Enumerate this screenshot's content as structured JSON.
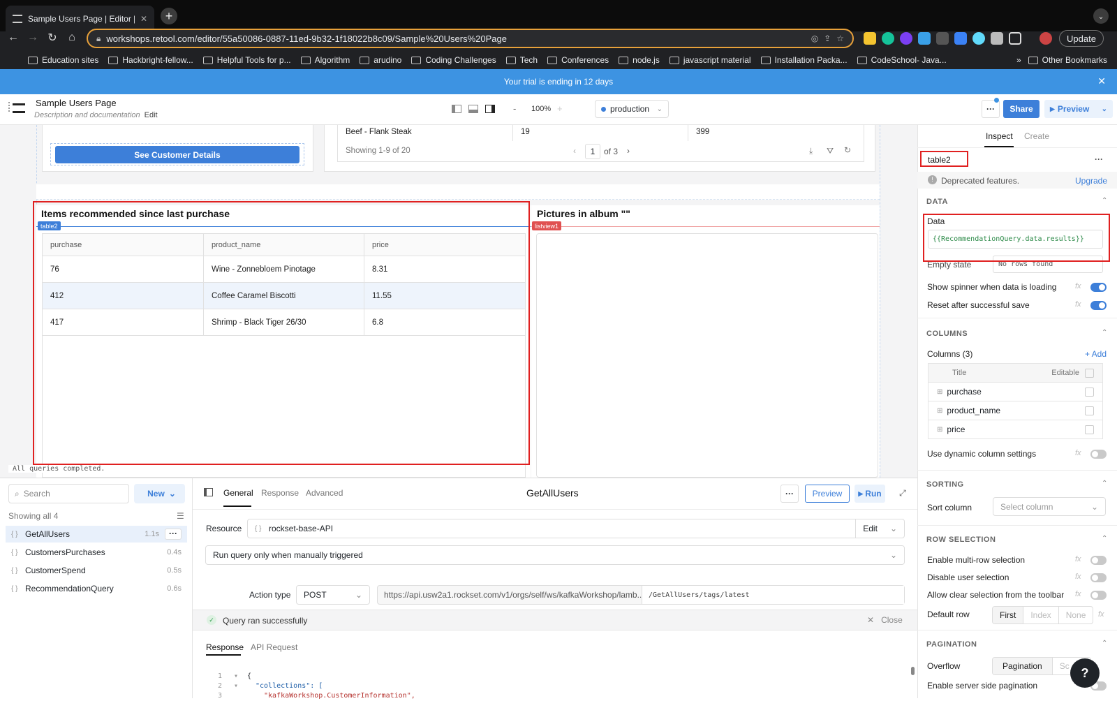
{
  "browser": {
    "tab_title": "Sample Users Page | Editor | Re",
    "url": "workshops.retool.com/editor/55a50086-0887-11ed-9b32-1f18022b8c09/Sample%20Users%20Page",
    "update_label": "Update",
    "bookmarks": [
      "Education sites",
      "Hackbright-fellow...",
      "Helpful Tools for p...",
      "Algorithm",
      "arudino",
      "Coding Challenges",
      "Tech",
      "Conferences",
      "node.js",
      "javascript material",
      "Installation Packa...",
      "CodeSchool- Java..."
    ],
    "other_bookmarks": "Other Bookmarks"
  },
  "trial_banner": "Your trial is ending in 12 days",
  "app": {
    "title": "Sample Users Page",
    "subtitle": "Description and documentation",
    "edit_label": "Edit",
    "zoom": "100%",
    "environment": "production",
    "share_label": "Share",
    "preview_label": "Preview"
  },
  "canvas": {
    "customer_button": "See Customer Details",
    "top_table": {
      "row": [
        "Beef - Flank Steak",
        "19",
        "399"
      ],
      "showing": "Showing 1-9 of 20",
      "page": "1",
      "of_pages": "of 3"
    },
    "table2": {
      "title": "Items recommended since last purchase",
      "tag": "table2",
      "columns": [
        "purchase",
        "product_name",
        "price"
      ],
      "rows": [
        [
          "76",
          "Wine - Zonnebloem Pinotage",
          "8.31"
        ],
        [
          "412",
          "Coffee Caramel Biscotti",
          "11.55"
        ],
        [
          "417",
          "Shrimp - Black Tiger 26/30",
          "6.8"
        ]
      ]
    },
    "listview": {
      "title": "Pictures in album \"\"",
      "tag": "listview1"
    },
    "status": "All queries completed."
  },
  "queries": {
    "search_placeholder": "Search",
    "new_label": "New",
    "showing": "Showing all 4",
    "items": [
      {
        "name": "GetAllUsers",
        "time": "1.1s"
      },
      {
        "name": "CustomersPurchases",
        "time": "0.4s"
      },
      {
        "name": "CustomerSpend",
        "time": "0.5s"
      },
      {
        "name": "RecommendationQuery",
        "time": "0.6s"
      }
    ]
  },
  "editor": {
    "tabs": [
      "General",
      "Response",
      "Advanced"
    ],
    "query_name": "GetAllUsers",
    "preview_label": "Preview",
    "run_label": "Run",
    "resource_label": "Resource",
    "resource": "rockset-base-API",
    "resource_edit": "Edit",
    "trigger": "Run query only when manually triggered",
    "action_label": "Action type",
    "method": "POST",
    "url_base": "https://api.usw2a1.rockset.com/v1/orgs/self/ws/kafkaWorkshop/lamb...",
    "url_path": "/GetAllUsers/tags/latest",
    "success": "Query ran successfully",
    "close_label": "Close",
    "response_tabs": [
      "Response",
      "API Request"
    ],
    "code_lines": [
      "{",
      "\"collections\": [",
      "\"kafkaWorkshop.CustomerInformation\","
    ],
    "line_numbers": [
      "1",
      "2",
      "3"
    ]
  },
  "inspector": {
    "tabs": [
      "Inspect",
      "Create"
    ],
    "component": "table2",
    "deprecated": "Deprecated features.",
    "upgrade": "Upgrade",
    "data_section": "DATA",
    "data_label": "Data",
    "data_value": "{{RecommendationQuery.data.results}}",
    "empty_label": "Empty state",
    "empty_value": "No rows found",
    "spinner_label": "Show spinner when data is loading",
    "reset_label": "Reset after successful save",
    "columns_section": "COLUMNS",
    "columns_label": "Columns (3)",
    "add_label": "+ Add",
    "col_title": "Title",
    "col_editable": "Editable",
    "columns": [
      "purchase",
      "product_name",
      "price"
    ],
    "dynamic_label": "Use dynamic column settings",
    "sorting_section": "SORTING",
    "sort_label": "Sort column",
    "sort_placeholder": "Select column",
    "rowsel_section": "ROW SELECTION",
    "multi_label": "Enable multi-row selection",
    "disable_label": "Disable user selection",
    "clear_label": "Allow clear selection from the toolbar",
    "default_row_label": "Default row",
    "default_row_options": [
      "First",
      "Index",
      "None"
    ],
    "pagination_section": "PAGINATION",
    "overflow_label": "Overflow",
    "overflow_options": [
      "Pagination",
      "Sc"
    ],
    "server_label": "Enable server side pagination"
  },
  "colors": {
    "accent": "#3d7fd9",
    "banner": "#3d93e2",
    "highlight": "#e02020"
  }
}
